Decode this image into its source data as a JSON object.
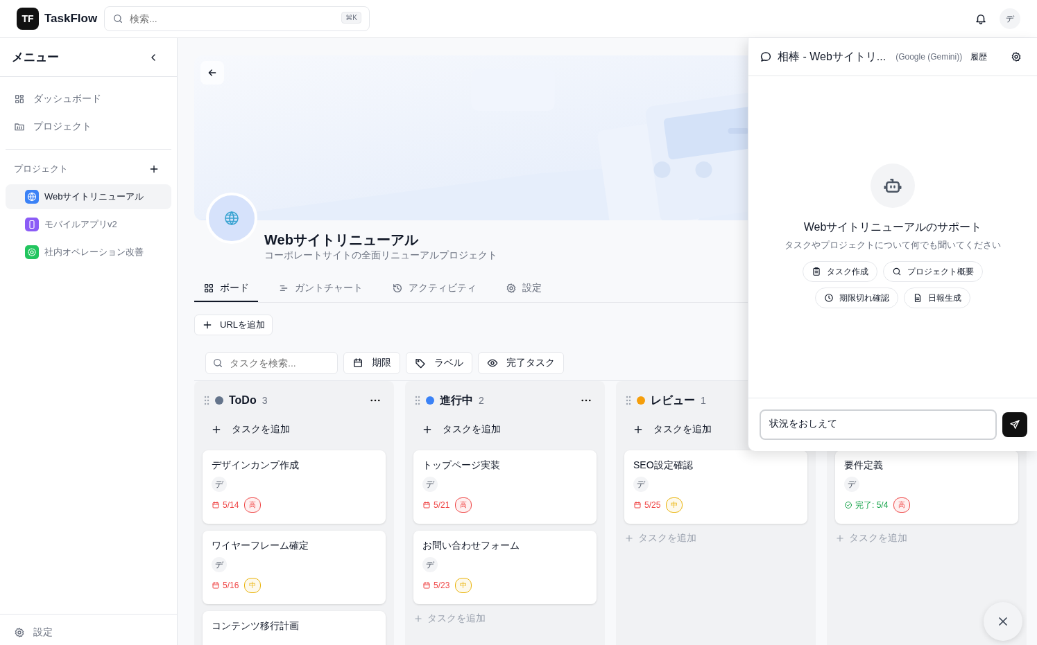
{
  "app": {
    "logo_mark": "TF",
    "name": "TaskFlow"
  },
  "search": {
    "placeholder": "検索...",
    "shortcut": "⌘K"
  },
  "user": {
    "initial": "デ"
  },
  "sidebar": {
    "title": "メニュー",
    "nav": [
      {
        "label": "ダッシュボード",
        "kind": "grid"
      },
      {
        "label": "プロジェクト",
        "kind": "folder"
      }
    ],
    "projects_heading": "プロジェクト",
    "projects": [
      {
        "name": "Webサイトリニューアル",
        "kind": "globe",
        "color": "#3b82f6",
        "selected": true
      },
      {
        "name": "モバイルアプリv2",
        "kind": "phone",
        "color": "#8b5cf6",
        "selected": false
      },
      {
        "name": "社内オペレーション改善",
        "kind": "gear",
        "color": "#22c55e",
        "selected": false
      }
    ],
    "footer": "設定"
  },
  "project": {
    "title": "Webサイトリニューアル",
    "description": "コーポレートサイトの全面リニューアルプロジェクト"
  },
  "tabs": [
    {
      "label": "ボード",
      "kind": "board",
      "selected": true
    },
    {
      "label": "ガントチャート",
      "kind": "gantt",
      "selected": false
    },
    {
      "label": "アクティビティ",
      "kind": "history",
      "selected": false
    },
    {
      "label": "設定",
      "kind": "gear",
      "selected": false
    }
  ],
  "add_url": "URLを追加",
  "filters": {
    "search_placeholder": "タスクを検索...",
    "buttons": [
      {
        "label": "期限",
        "kind": "calendar"
      },
      {
        "label": "ラベル",
        "kind": "tag"
      },
      {
        "label": "完了タスク",
        "kind": "eye"
      }
    ]
  },
  "columns": [
    {
      "title": "ToDo",
      "count": "3",
      "color": "#64748b",
      "menu": true,
      "add_label": "タスクを追加",
      "cards": [
        {
          "title": "デザインカンプ作成",
          "assignee": "デ",
          "due": "5/14",
          "done": false,
          "priority": {
            "label": "高",
            "color": "#ef4444"
          }
        },
        {
          "title": "ワイヤーフレーム確定",
          "assignee": "デ",
          "due": "5/16",
          "done": false,
          "priority": {
            "label": "中",
            "color": "#eab308"
          }
        },
        {
          "title": "コンテンツ移行計画"
        }
      ]
    },
    {
      "title": "進行中",
      "count": "2",
      "color": "#3b82f6",
      "menu": true,
      "add_label": "タスクを追加",
      "cards": [
        {
          "title": "トップページ実装",
          "assignee": "デ",
          "due": "5/21",
          "done": false,
          "priority": {
            "label": "高",
            "color": "#ef4444"
          }
        },
        {
          "title": "お問い合わせフォーム",
          "assignee": "デ",
          "due": "5/23",
          "done": false,
          "priority": {
            "label": "中",
            "color": "#eab308"
          }
        }
      ],
      "bottom_add": "タスクを追加"
    },
    {
      "title": "レビュー",
      "count": "1",
      "color": "#f59e0b",
      "menu": false,
      "add_label": "タスクを追加",
      "cards": [
        {
          "title": "SEO設定確認",
          "assignee": "デ",
          "due": "5/25",
          "done": false,
          "priority": {
            "label": "中",
            "color": "#eab308"
          }
        }
      ],
      "bottom_add": "タスクを追加"
    },
    {
      "cards": [
        {
          "title": "要件定義",
          "assignee": "デ",
          "due": "完了: 5/4",
          "done": true,
          "priority": {
            "label": "高",
            "color": "#ef4444"
          }
        }
      ],
      "bottom_add": "タスクを追加"
    }
  ],
  "chat": {
    "title": "相棒 - Webサイトリ...",
    "model": "(Google (Gemini))",
    "history": "履歴",
    "heading": "Webサイトリニューアルのサポート",
    "subheading": "タスクやプロジェクトについて何でも聞いてください",
    "action_rows": [
      [
        {
          "label": "タスク作成",
          "kind": "clipboard"
        },
        {
          "label": "プロジェクト概要",
          "kind": "search"
        }
      ],
      [
        {
          "label": "期限切れ確認",
          "kind": "clock"
        },
        {
          "label": "日報生成",
          "kind": "file"
        }
      ]
    ],
    "input_value": "状況をおしえて"
  }
}
